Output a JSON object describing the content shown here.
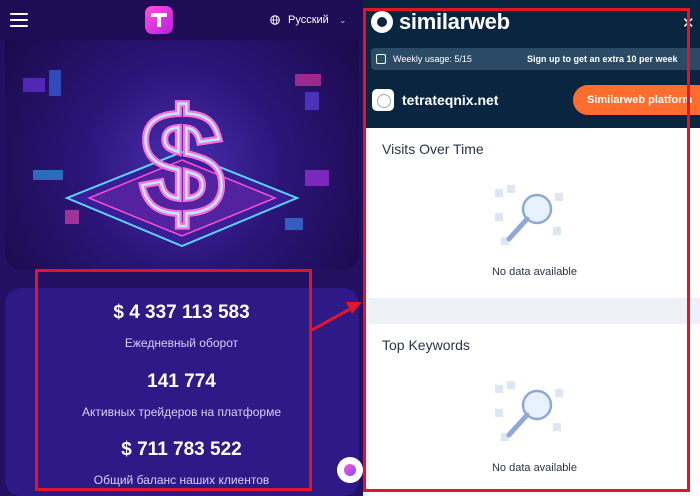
{
  "left_app": {
    "language": "Русский",
    "stats": [
      {
        "value": "$ 4 337 113 583",
        "label": "Ежедневный оборот"
      },
      {
        "value": "141 774",
        "label": "Активных трейдеров на платформе"
      },
      {
        "value": "$ 711 783 522",
        "label": "Общий баланс наших клиентов"
      }
    ]
  },
  "similarweb": {
    "brand": "similarweb",
    "usage_label": "Weekly usage: 5/15",
    "upsell": "Sign up to get an extra 10 per week",
    "site": "tetrateqnix.net",
    "platform_button": "Similarweb platform",
    "sections": [
      {
        "title": "Visits Over Time",
        "empty_text": "No data available"
      },
      {
        "title": "Top Keywords",
        "empty_text": "No data available"
      }
    ]
  },
  "colors": {
    "left_bg": "#241063",
    "sw_header": "#092540",
    "accent_orange": "#ff6d2e",
    "highlight_red": "#e0142a"
  },
  "icons": [
    "menu-icon",
    "app-logo-icon",
    "globe-icon",
    "chevron-down-icon",
    "chat-assistant-icon",
    "similarweb-logo-icon",
    "close-icon",
    "usage-icon",
    "site-favicon-icon",
    "magnifier-illustration-icon"
  ]
}
